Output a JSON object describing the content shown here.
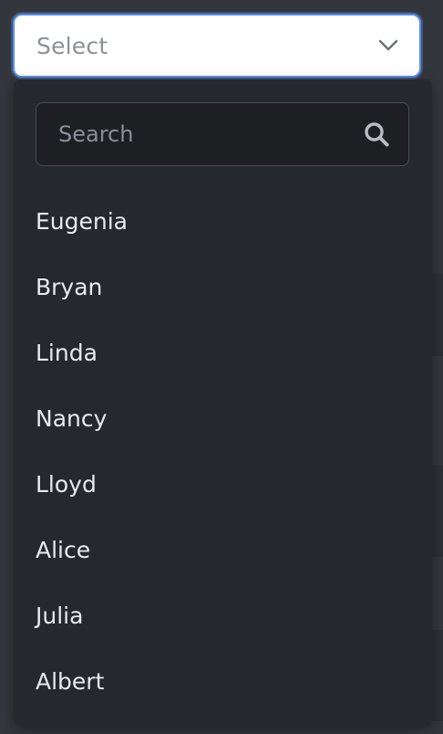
{
  "select": {
    "placeholder": "Select",
    "chevron_icon": "chevron-down-icon"
  },
  "search": {
    "placeholder": "Search",
    "value": "",
    "icon": "search-icon"
  },
  "options": [
    {
      "label": "Eugenia"
    },
    {
      "label": "Bryan"
    },
    {
      "label": "Linda"
    },
    {
      "label": "Nancy"
    },
    {
      "label": "Lloyd"
    },
    {
      "label": "Alice"
    },
    {
      "label": "Julia"
    },
    {
      "label": "Albert"
    }
  ],
  "colors": {
    "page_bg": "#33363c",
    "dropdown_bg": "#25282d",
    "search_bg": "#1d1f23",
    "focus_border": "#5b8ee6",
    "option_text": "#e8eaed",
    "placeholder_text": "#8c9096"
  }
}
